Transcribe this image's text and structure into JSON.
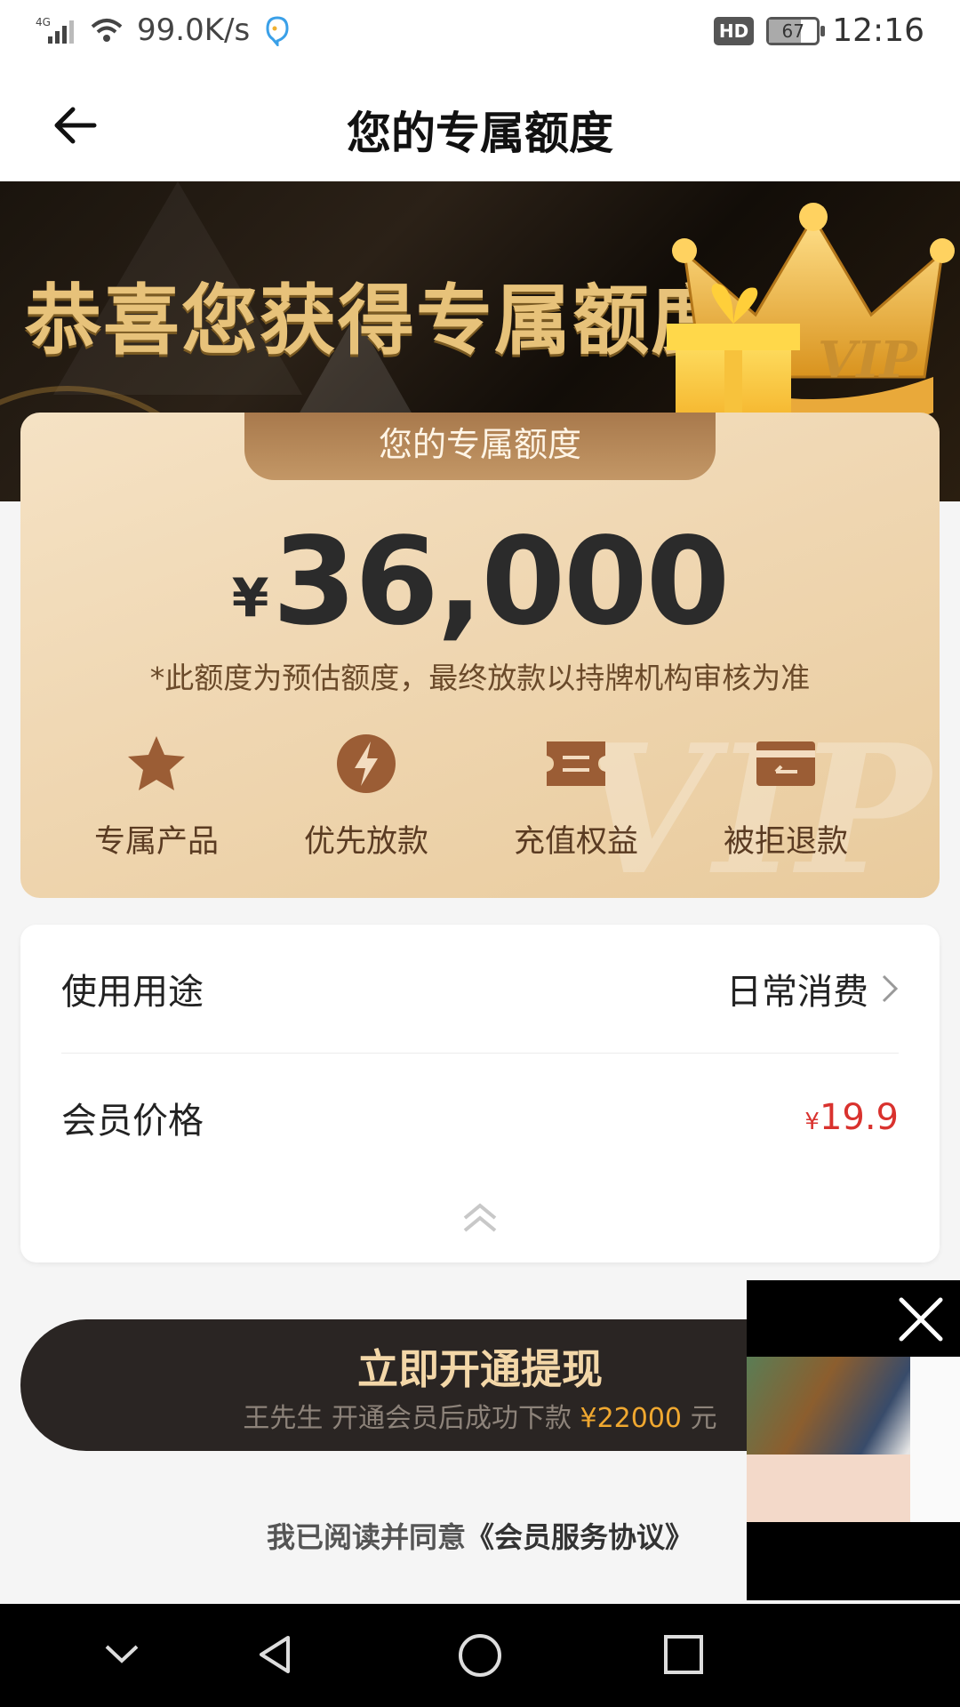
{
  "status_bar": {
    "network": "4G",
    "speed": "99.0K/s",
    "hd": "HD",
    "battery": "67",
    "battery_level": 0.67,
    "time": "12:16"
  },
  "navbar": {
    "title": "您的专属额度"
  },
  "banner": {
    "headline": "恭喜您获得专属额度",
    "badge": "VIP"
  },
  "quota_card": {
    "tab_label": "您的专属额度",
    "currency": "¥",
    "amount": "36,000",
    "note": "*此额度为预估额度，最终放款以持牌机构审核为准",
    "watermark": "VIP",
    "benefits": [
      {
        "label": "专属产品",
        "icon": "star-icon"
      },
      {
        "label": "优先放款",
        "icon": "lightning-icon"
      },
      {
        "label": "充值权益",
        "icon": "ticket-icon"
      },
      {
        "label": "被拒退款",
        "icon": "card-refund-icon"
      }
    ]
  },
  "info_card": {
    "usage_label": "使用用途",
    "usage_value": "日常消费",
    "price_label": "会员价格",
    "price_currency": "¥",
    "price_value": "19.9"
  },
  "cta": {
    "title": "立即开通提现",
    "sub_prefix": "王先生 开通会员后成功下款 ",
    "sub_amount": "¥22000",
    "sub_suffix": " 元"
  },
  "agreement": {
    "prefix": "我已阅读并同意",
    "link": "《会员服务协议》"
  },
  "colors": {
    "accent_gold": "#f3d7a8",
    "price_red": "#d9322e",
    "amount_orange": "#f0a830",
    "button_dark": "#2a2523"
  }
}
